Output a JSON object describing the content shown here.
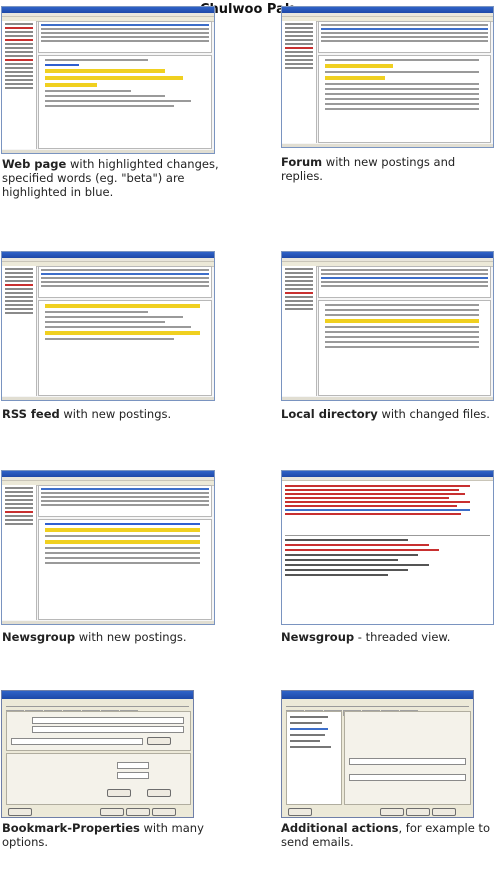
{
  "header": {
    "author": "Chulwoo Pak"
  },
  "panels": [
    {
      "title": "Web page",
      "caption": "with highlighted changes, specified words (eg. \"beta\") are highlighted in blue."
    },
    {
      "title": "Forum",
      "caption": "with new postings and replies."
    },
    {
      "title": "RSS feed",
      "caption": "with new postings."
    },
    {
      "title": "Local directory",
      "caption": "with changed files."
    },
    {
      "title": "Newsgroup",
      "caption": "with new postings."
    },
    {
      "title": "Newsgroup",
      "caption": "- threaded view."
    },
    {
      "title": "Bookmark-Properties",
      "caption": "with many options."
    },
    {
      "title": "Additional actions",
      "caption": ", for example to send emails."
    }
  ],
  "colors": {
    "titlebar": "#1d48a8",
    "highlight_changes": "#f0d020",
    "highlight_words": "#2f5fd0"
  }
}
